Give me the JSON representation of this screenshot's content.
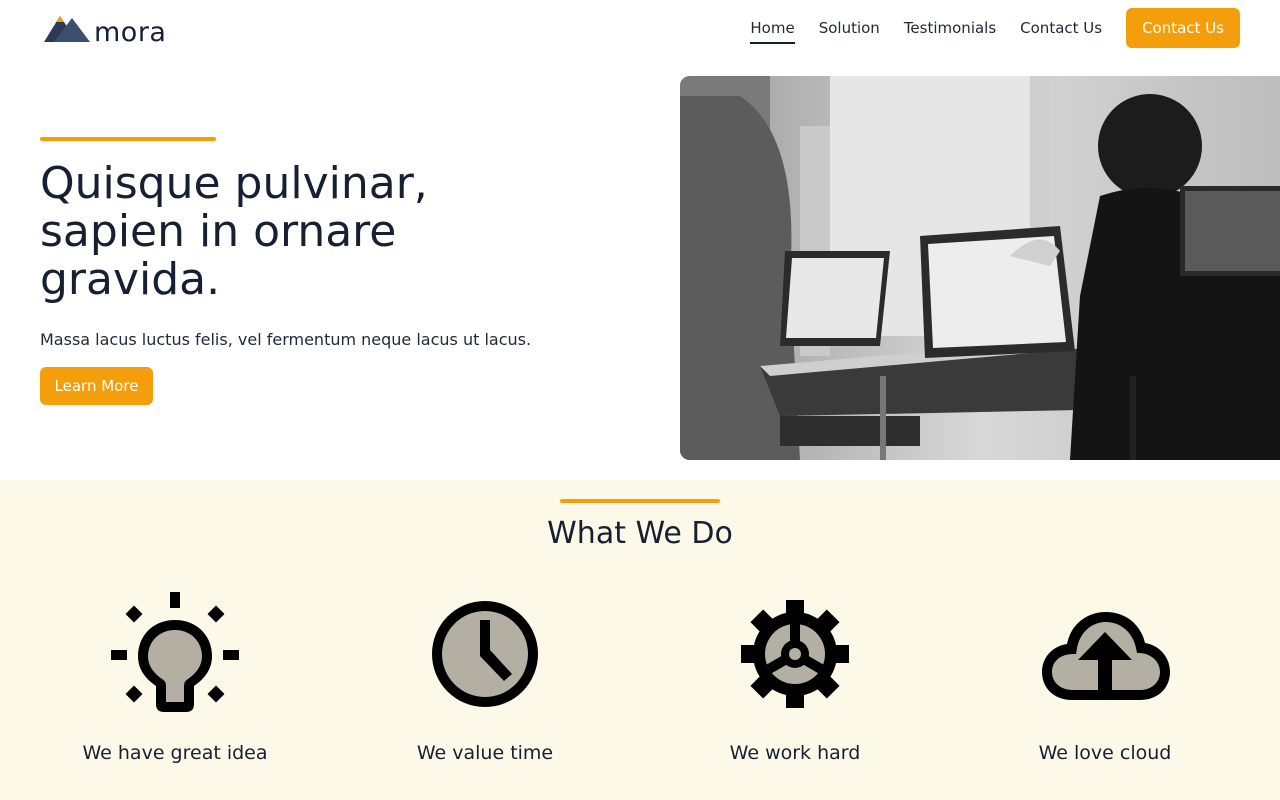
{
  "brand": {
    "name": "mora",
    "accent_color": "#f59e0b",
    "dark_color": "#172033"
  },
  "nav": {
    "items": [
      {
        "label": "Home",
        "active": true
      },
      {
        "label": "Solution",
        "active": false
      },
      {
        "label": "Testimonials",
        "active": false
      },
      {
        "label": "Contact Us",
        "active": false
      }
    ],
    "cta_label": "Contact Us"
  },
  "hero": {
    "title": "Quisque pulvinar, sapien in ornare gravida.",
    "subtitle": "Massa lacus luctus felis, vel fermentum neque lacus ut lacus.",
    "button_label": "Learn More",
    "image": "grayscale-office-photo"
  },
  "what_we_do": {
    "title": "What We Do",
    "background": "#fdf9e8",
    "features": [
      {
        "icon": "lightbulb-icon",
        "label": "We have great idea"
      },
      {
        "icon": "clock-icon",
        "label": "We value time"
      },
      {
        "icon": "gear-icon",
        "label": "We work hard"
      },
      {
        "icon": "cloud-upload-icon",
        "label": "We love cloud"
      }
    ]
  }
}
